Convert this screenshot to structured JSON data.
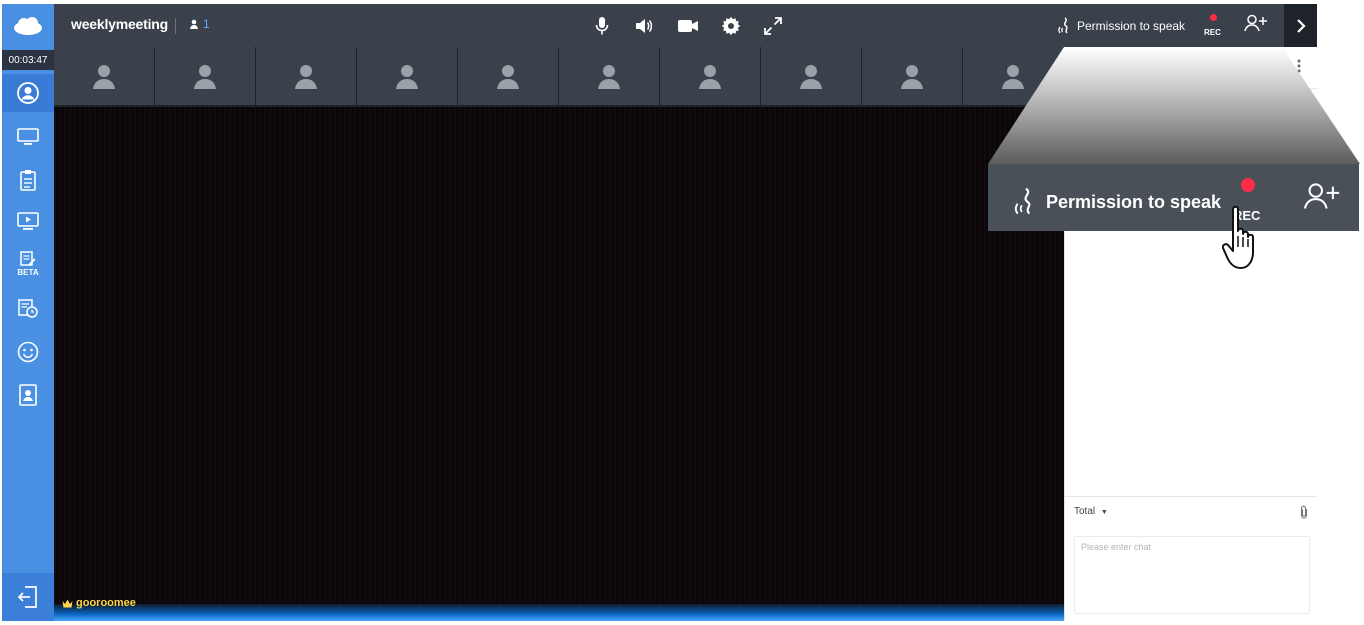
{
  "header": {
    "room_name": "weeklymeeting",
    "participant_count": "1"
  },
  "sidebar": {
    "timer": "00:03:47",
    "items": [
      {
        "icon": "profile-icon"
      },
      {
        "icon": "screen-share-icon"
      },
      {
        "icon": "document-icon"
      },
      {
        "icon": "video-play-icon"
      },
      {
        "icon": "whiteboard-icon",
        "badge": "BETA"
      },
      {
        "icon": "schedule-icon"
      },
      {
        "icon": "emoji-icon"
      },
      {
        "icon": "contact-card-icon"
      }
    ],
    "exit_icon": "exit-icon"
  },
  "toolbar": {
    "controls": [
      "microphone-icon",
      "speaker-icon",
      "camera-icon",
      "settings-icon",
      "fullscreen-icon"
    ],
    "permission_label": "Permission to speak",
    "rec_label": "REC",
    "invite_icon": "add-user-icon"
  },
  "participants_strip": {
    "slot_count": 10
  },
  "video": {
    "owner_name": "gooroomee"
  },
  "chat": {
    "filter_label": "Total",
    "input_placeholder": "Please enter chat"
  },
  "callout": {
    "permission_label": "Permission to speak",
    "rec_label": "REC"
  },
  "colors": {
    "sidebar_blue": "#4a90e2",
    "topbar_dark": "#3a414b",
    "rec_red": "#ff2b4a",
    "count_blue": "#5fa8ff",
    "owner_gold": "#ffd84a"
  }
}
